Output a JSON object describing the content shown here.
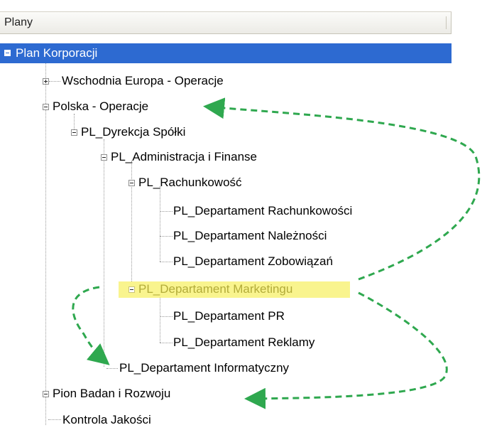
{
  "panel": {
    "header_title": "Plany"
  },
  "tree": {
    "root": "Plan Korporacji",
    "items": [
      "Wschodnia Europa - Operacje",
      "Polska - Operacje",
      "PL_Dyrekcja Spółki",
      "PL_Administracja  i  Finanse",
      "PL_Rachunkowość",
      "PL_Departament Rachunkowości",
      "PL_Departament Należności",
      "PL_Departament Zobowiązań",
      "PL_Departament Marketingu",
      "PL_Departament PR",
      "PL_Departament Reklamy",
      "PL_Departament Informatyczny",
      "Pion Badan i Rozwoju",
      "Kontrola Jakości"
    ]
  },
  "colors": {
    "selection": "#2d6ad1",
    "highlight": "#f9f48e",
    "annotation_arrow": "#2fa84f"
  }
}
